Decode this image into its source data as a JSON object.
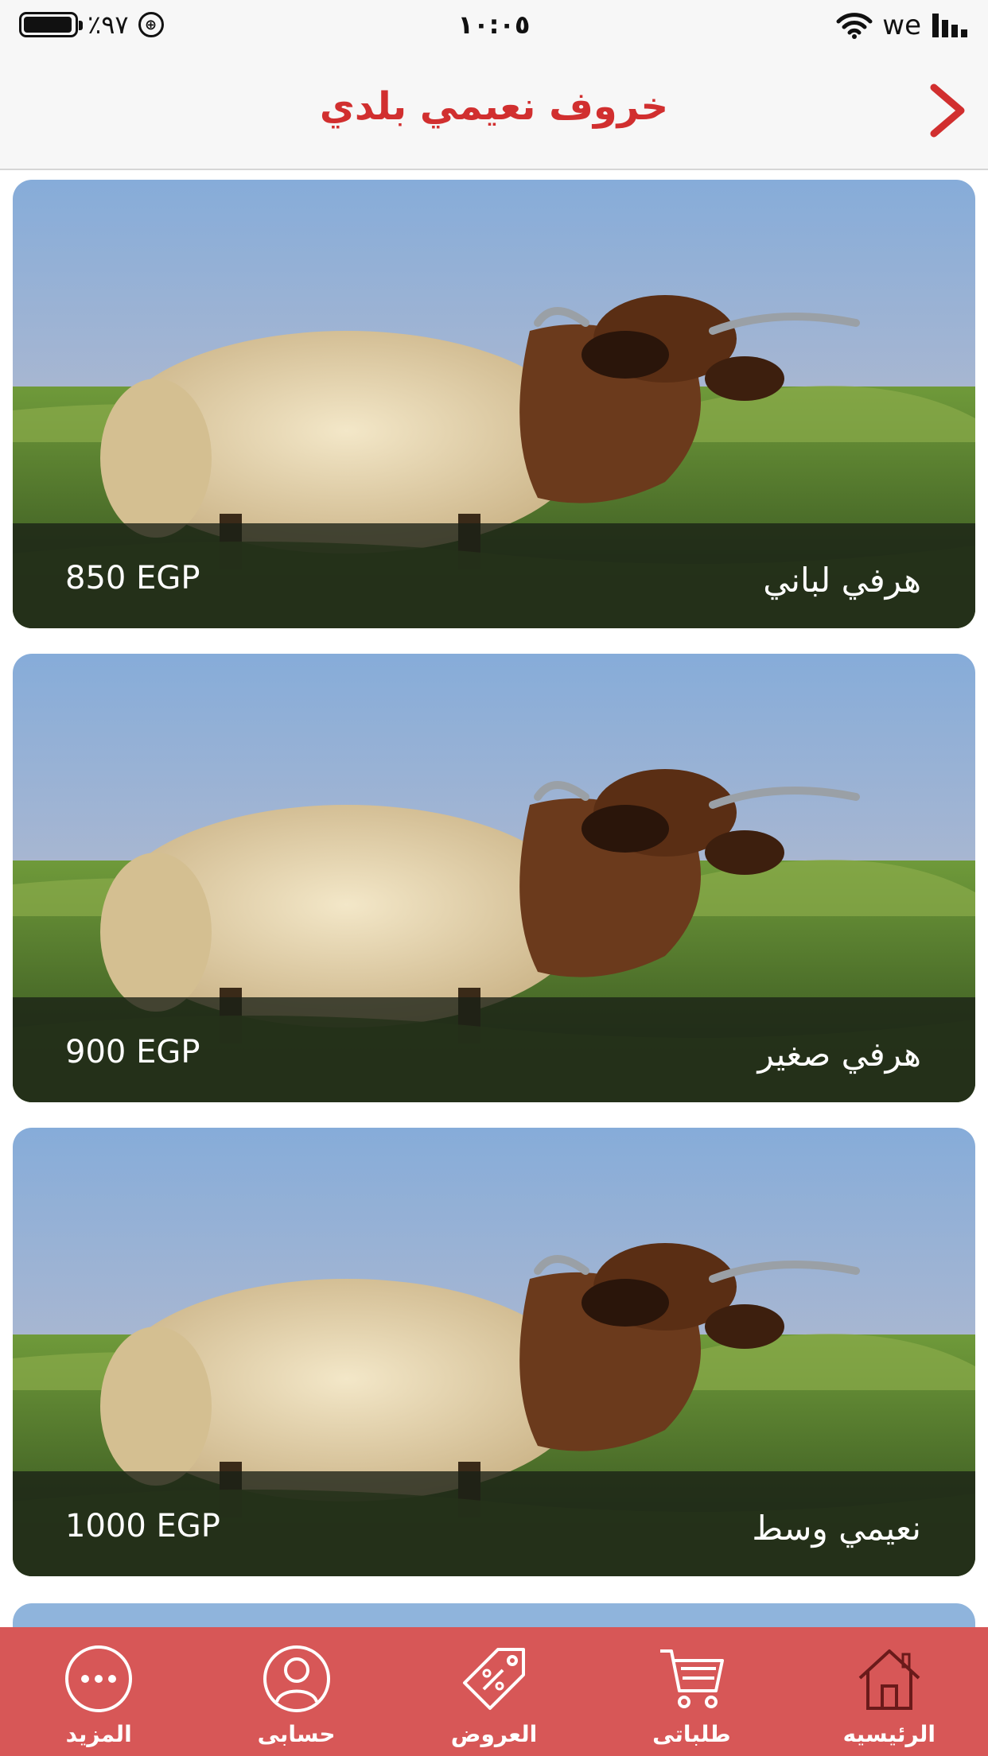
{
  "status_bar": {
    "battery_percent_text": "٪٩٧",
    "battery_level": 0.97,
    "time": "١٠:٠٥",
    "carrier": "we"
  },
  "header": {
    "title": "خروف نعيمي بلدي",
    "back_icon": "chevron-right-icon"
  },
  "products": [
    {
      "name": "هرفي لباني",
      "price": "850 EGP"
    },
    {
      "name": "هرفي صغير",
      "price": "900 EGP"
    },
    {
      "name": "نعيمي وسط",
      "price": "1000 EGP"
    }
  ],
  "tabs": [
    {
      "label": "الرئيسيه",
      "icon": "home-icon",
      "active": true
    },
    {
      "label": "طلباتى",
      "icon": "cart-icon",
      "active": false
    },
    {
      "label": "العروض",
      "icon": "tag-icon",
      "active": false
    },
    {
      "label": "حسابى",
      "icon": "user-icon",
      "active": false
    },
    {
      "label": "المزيد",
      "icon": "more-icon",
      "active": false
    }
  ],
  "colors": {
    "accent": "#d12f2f",
    "tab_bar": "#d75757",
    "active_tab": "#6a1a1a"
  }
}
